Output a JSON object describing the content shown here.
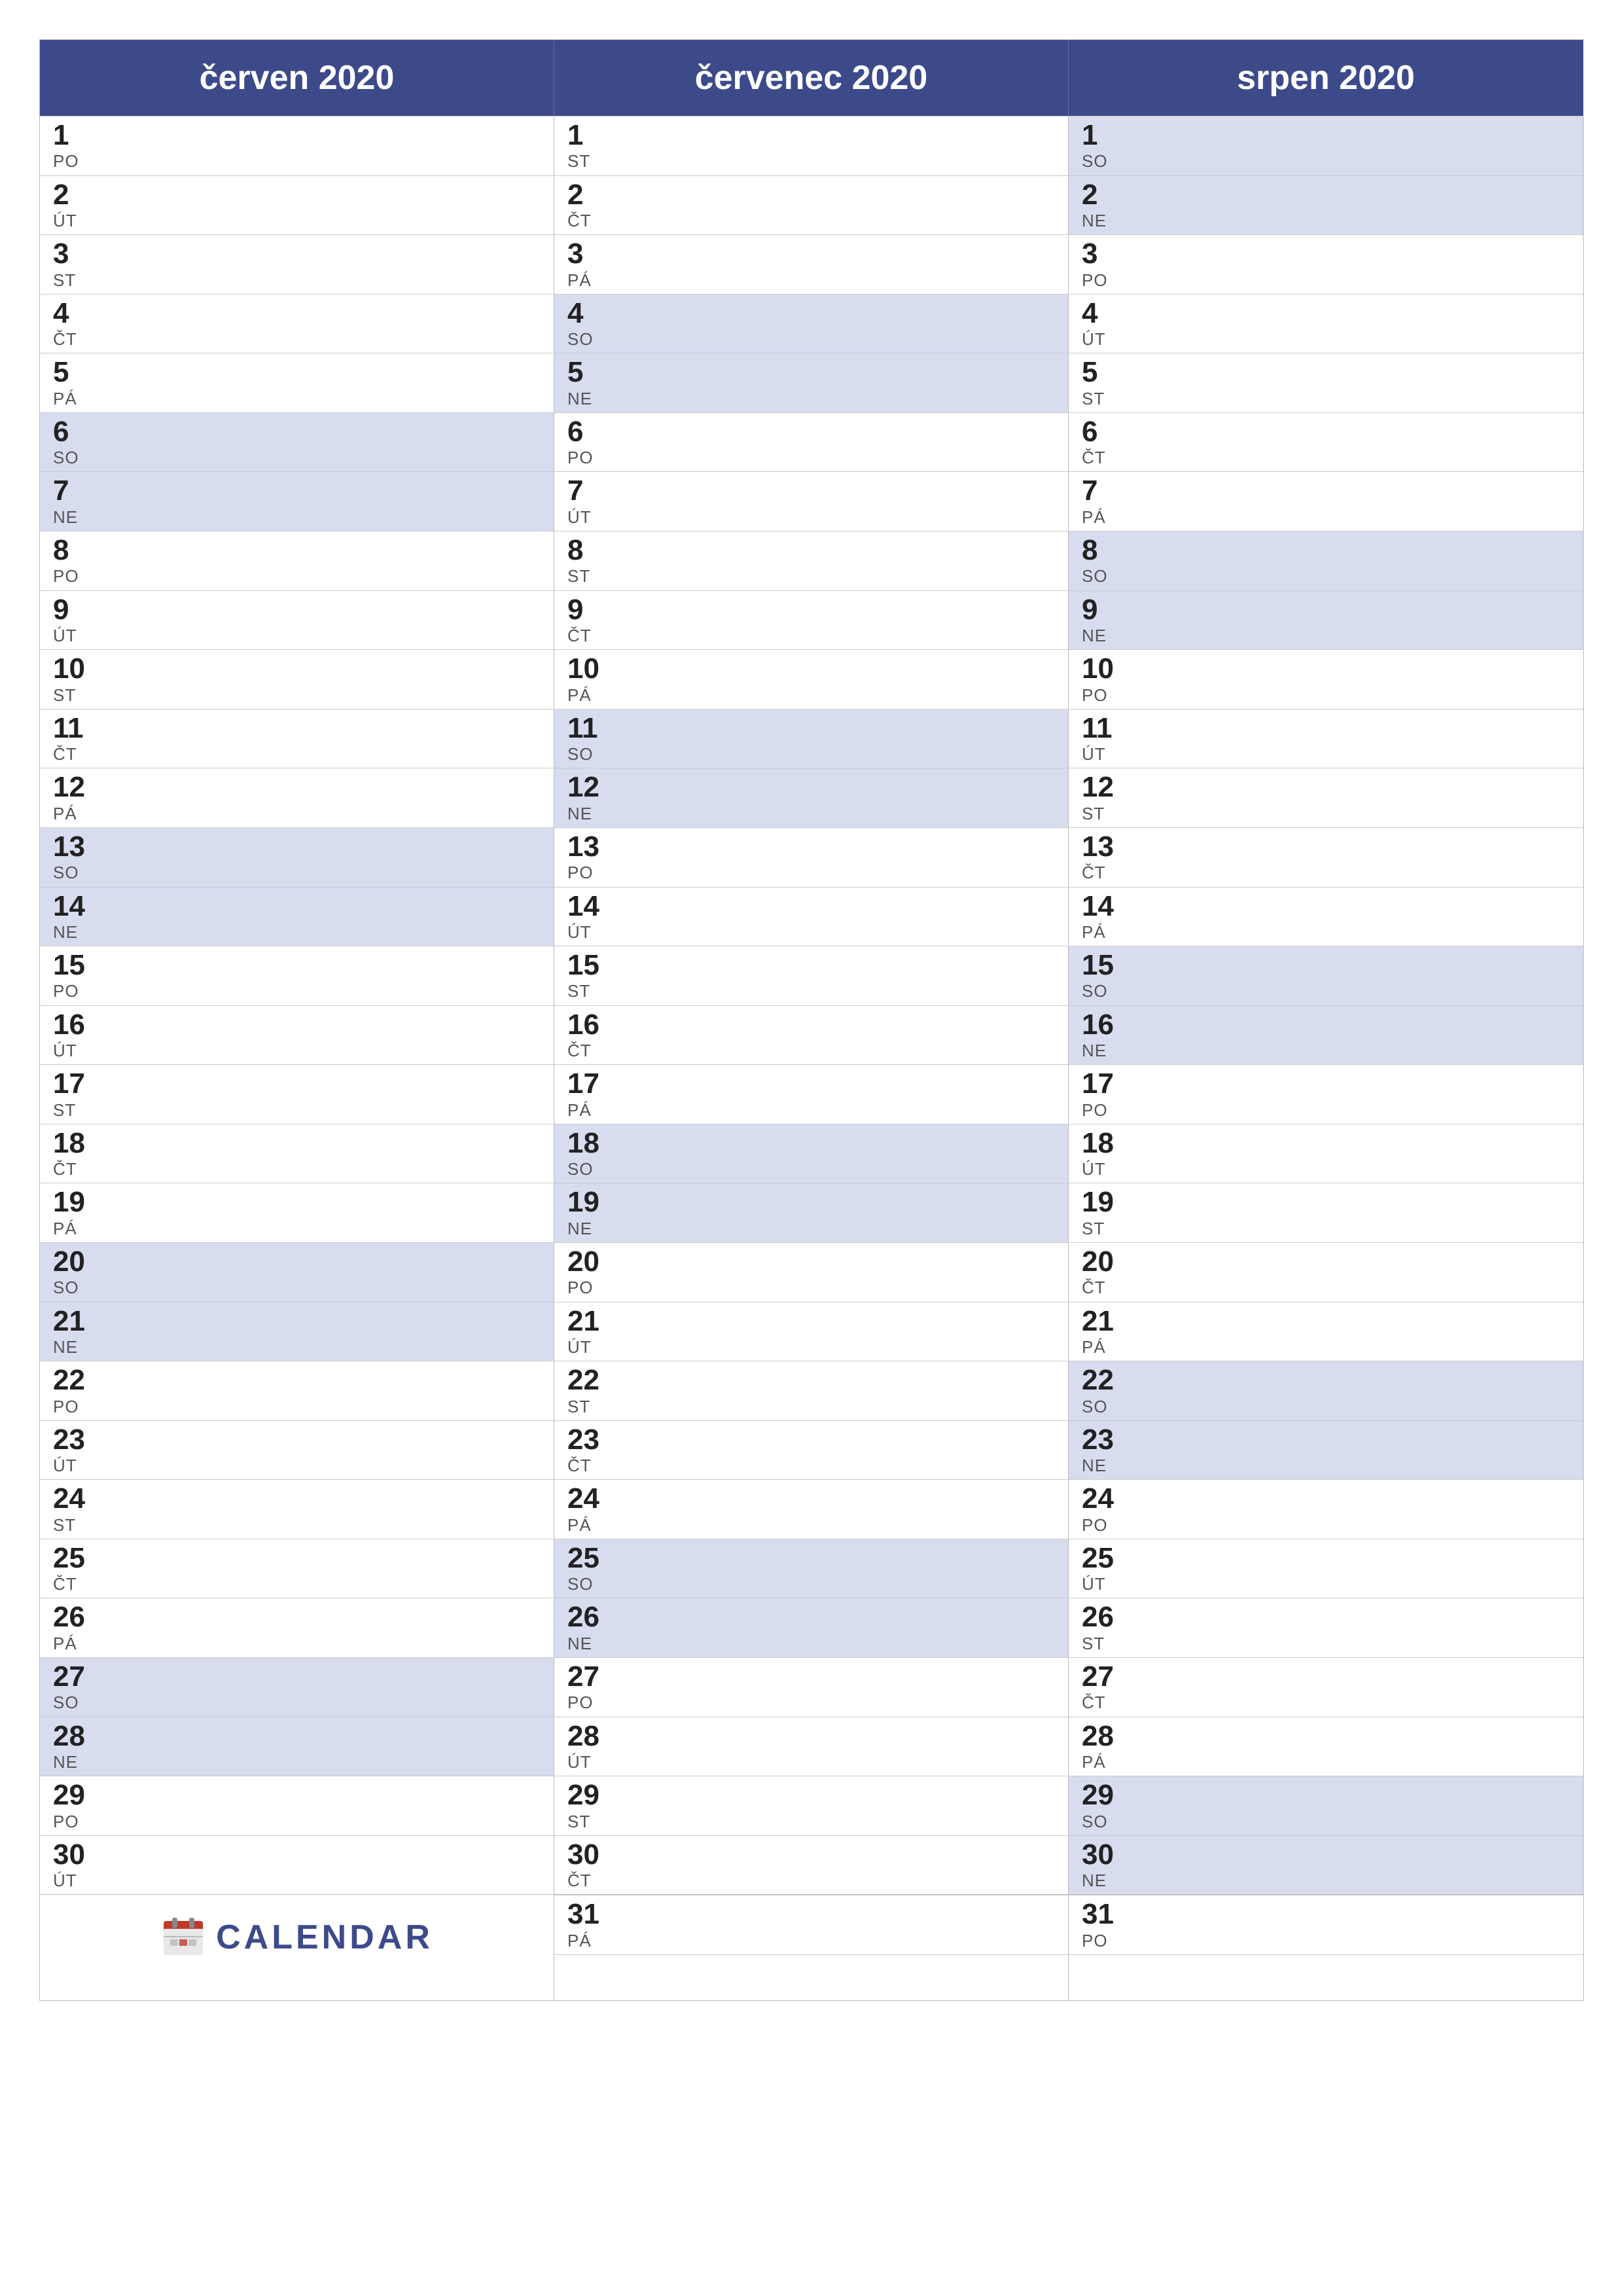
{
  "months": [
    {
      "name": "červen 2020",
      "id": "june",
      "days": [
        {
          "num": "1",
          "day": "PO",
          "weekend": false
        },
        {
          "num": "2",
          "day": "ÚT",
          "weekend": false
        },
        {
          "num": "3",
          "day": "ST",
          "weekend": false
        },
        {
          "num": "4",
          "day": "ČT",
          "weekend": false
        },
        {
          "num": "5",
          "day": "PÁ",
          "weekend": false
        },
        {
          "num": "6",
          "day": "SO",
          "weekend": true
        },
        {
          "num": "7",
          "day": "NE",
          "weekend": true
        },
        {
          "num": "8",
          "day": "PO",
          "weekend": false
        },
        {
          "num": "9",
          "day": "ÚT",
          "weekend": false
        },
        {
          "num": "10",
          "day": "ST",
          "weekend": false
        },
        {
          "num": "11",
          "day": "ČT",
          "weekend": false
        },
        {
          "num": "12",
          "day": "PÁ",
          "weekend": false
        },
        {
          "num": "13",
          "day": "SO",
          "weekend": true
        },
        {
          "num": "14",
          "day": "NE",
          "weekend": true
        },
        {
          "num": "15",
          "day": "PO",
          "weekend": false
        },
        {
          "num": "16",
          "day": "ÚT",
          "weekend": false
        },
        {
          "num": "17",
          "day": "ST",
          "weekend": false
        },
        {
          "num": "18",
          "day": "ČT",
          "weekend": false
        },
        {
          "num": "19",
          "day": "PÁ",
          "weekend": false
        },
        {
          "num": "20",
          "day": "SO",
          "weekend": true
        },
        {
          "num": "21",
          "day": "NE",
          "weekend": true
        },
        {
          "num": "22",
          "day": "PO",
          "weekend": false
        },
        {
          "num": "23",
          "day": "ÚT",
          "weekend": false
        },
        {
          "num": "24",
          "day": "ST",
          "weekend": false
        },
        {
          "num": "25",
          "day": "ČT",
          "weekend": false
        },
        {
          "num": "26",
          "day": "PÁ",
          "weekend": false
        },
        {
          "num": "27",
          "day": "SO",
          "weekend": true
        },
        {
          "num": "28",
          "day": "NE",
          "weekend": true
        },
        {
          "num": "29",
          "day": "PO",
          "weekend": false
        },
        {
          "num": "30",
          "day": "ÚT",
          "weekend": false
        }
      ]
    },
    {
      "name": "červenec 2020",
      "id": "july",
      "days": [
        {
          "num": "1",
          "day": "ST",
          "weekend": false
        },
        {
          "num": "2",
          "day": "ČT",
          "weekend": false
        },
        {
          "num": "3",
          "day": "PÁ",
          "weekend": false
        },
        {
          "num": "4",
          "day": "SO",
          "weekend": true
        },
        {
          "num": "5",
          "day": "NE",
          "weekend": true
        },
        {
          "num": "6",
          "day": "PO",
          "weekend": false
        },
        {
          "num": "7",
          "day": "ÚT",
          "weekend": false
        },
        {
          "num": "8",
          "day": "ST",
          "weekend": false
        },
        {
          "num": "9",
          "day": "ČT",
          "weekend": false
        },
        {
          "num": "10",
          "day": "PÁ",
          "weekend": false
        },
        {
          "num": "11",
          "day": "SO",
          "weekend": true
        },
        {
          "num": "12",
          "day": "NE",
          "weekend": true
        },
        {
          "num": "13",
          "day": "PO",
          "weekend": false
        },
        {
          "num": "14",
          "day": "ÚT",
          "weekend": false
        },
        {
          "num": "15",
          "day": "ST",
          "weekend": false
        },
        {
          "num": "16",
          "day": "ČT",
          "weekend": false
        },
        {
          "num": "17",
          "day": "PÁ",
          "weekend": false
        },
        {
          "num": "18",
          "day": "SO",
          "weekend": true
        },
        {
          "num": "19",
          "day": "NE",
          "weekend": true
        },
        {
          "num": "20",
          "day": "PO",
          "weekend": false
        },
        {
          "num": "21",
          "day": "ÚT",
          "weekend": false
        },
        {
          "num": "22",
          "day": "ST",
          "weekend": false
        },
        {
          "num": "23",
          "day": "ČT",
          "weekend": false
        },
        {
          "num": "24",
          "day": "PÁ",
          "weekend": false
        },
        {
          "num": "25",
          "day": "SO",
          "weekend": true
        },
        {
          "num": "26",
          "day": "NE",
          "weekend": true
        },
        {
          "num": "27",
          "day": "PO",
          "weekend": false
        },
        {
          "num": "28",
          "day": "ÚT",
          "weekend": false
        },
        {
          "num": "29",
          "day": "ST",
          "weekend": false
        },
        {
          "num": "30",
          "day": "ČT",
          "weekend": false
        },
        {
          "num": "31",
          "day": "PÁ",
          "weekend": false
        }
      ]
    },
    {
      "name": "srpen 2020",
      "id": "august",
      "days": [
        {
          "num": "1",
          "day": "SO",
          "weekend": true
        },
        {
          "num": "2",
          "day": "NE",
          "weekend": true
        },
        {
          "num": "3",
          "day": "PO",
          "weekend": false
        },
        {
          "num": "4",
          "day": "ÚT",
          "weekend": false
        },
        {
          "num": "5",
          "day": "ST",
          "weekend": false
        },
        {
          "num": "6",
          "day": "ČT",
          "weekend": false
        },
        {
          "num": "7",
          "day": "PÁ",
          "weekend": false
        },
        {
          "num": "8",
          "day": "SO",
          "weekend": true
        },
        {
          "num": "9",
          "day": "NE",
          "weekend": true
        },
        {
          "num": "10",
          "day": "PO",
          "weekend": false
        },
        {
          "num": "11",
          "day": "ÚT",
          "weekend": false
        },
        {
          "num": "12",
          "day": "ST",
          "weekend": false
        },
        {
          "num": "13",
          "day": "ČT",
          "weekend": false
        },
        {
          "num": "14",
          "day": "PÁ",
          "weekend": false
        },
        {
          "num": "15",
          "day": "SO",
          "weekend": true
        },
        {
          "num": "16",
          "day": "NE",
          "weekend": true
        },
        {
          "num": "17",
          "day": "PO",
          "weekend": false
        },
        {
          "num": "18",
          "day": "ÚT",
          "weekend": false
        },
        {
          "num": "19",
          "day": "ST",
          "weekend": false
        },
        {
          "num": "20",
          "day": "ČT",
          "weekend": false
        },
        {
          "num": "21",
          "day": "PÁ",
          "weekend": false
        },
        {
          "num": "22",
          "day": "SO",
          "weekend": true
        },
        {
          "num": "23",
          "day": "NE",
          "weekend": true
        },
        {
          "num": "24",
          "day": "PO",
          "weekend": false
        },
        {
          "num": "25",
          "day": "ÚT",
          "weekend": false
        },
        {
          "num": "26",
          "day": "ST",
          "weekend": false
        },
        {
          "num": "27",
          "day": "ČT",
          "weekend": false
        },
        {
          "num": "28",
          "day": "PÁ",
          "weekend": false
        },
        {
          "num": "29",
          "day": "SO",
          "weekend": true
        },
        {
          "num": "30",
          "day": "NE",
          "weekend": true
        },
        {
          "num": "31",
          "day": "PO",
          "weekend": false
        }
      ]
    }
  ],
  "brand": {
    "text": "CALENDAR",
    "color": "#3d4a8a"
  }
}
